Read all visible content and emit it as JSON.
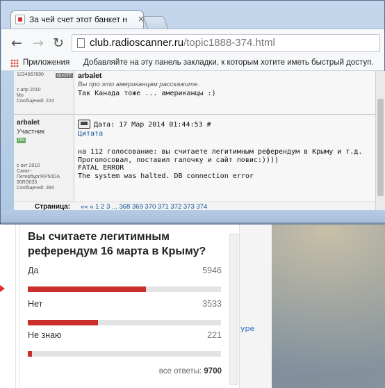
{
  "browser": {
    "tab_title": "За чей счет этот банкет н",
    "tab_close": "×",
    "url_host": "club.radioscanner.ru",
    "url_path": "/topic1888-374.html",
    "apps_label": "Приложения",
    "bookmarks_hint": "Добавляйте на эту панель закладки, к которым хотите иметь быстрый доступ."
  },
  "forum": {
    "post1": {
      "meta_top": "1234567890",
      "meta_since": "с апр 2010",
      "meta_location": "Мо",
      "meta_messages": "Сообщений: 224",
      "quoted_author": "arbalet",
      "quoted_text": "Вы про это американцам расскажите.",
      "reply_text": "Так Канада тоже ... американцы :)"
    },
    "post2": {
      "author": "arbalet",
      "role": "Участник",
      "status": "ON",
      "since": "с окт 2010",
      "location1": "Санкт-",
      "location2": "Петербург/KP50DA",
      "location3": "90RS033",
      "messages": "Сообщений: 394",
      "date": "Дата: 17 Мар 2014 01:44:53 #",
      "quote_link": "Цитата",
      "body": "на 112 голосование: вы считаете легитимным референдум в Крыму и т.д.\nПроголосовал, поставил галочку и сайт повис:))))\nFATAL ERROR\nThe system was halted. DB connection error"
    },
    "pagination": {
      "label": "Страница:",
      "pages": "«« «  1  2  3  ...  368  369  370  371  372  373  374"
    }
  },
  "poll": {
    "title": "Вы считаете легитимным референдум 16 марта в Крыму?",
    "options": [
      {
        "label": "Да",
        "count": "5946",
        "share": 0.6126
      },
      {
        "label": "Нет",
        "count": "3533",
        "share": 0.364
      },
      {
        "label": "Не знаю",
        "count": "221",
        "share": 0.0228
      }
    ],
    "total_label": "все ответы:",
    "total_value": "9700",
    "bar_color": "#c9302c"
  },
  "side": {
    "link_fragment": "уре"
  }
}
